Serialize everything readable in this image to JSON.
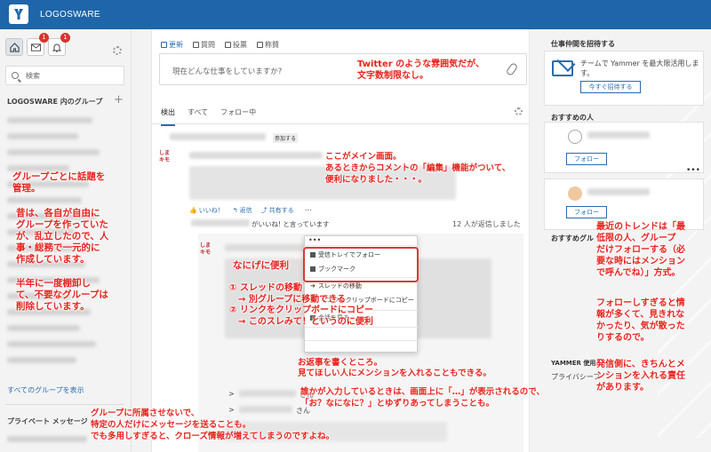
{
  "app": {
    "brand": "LOGOSWARE"
  },
  "left": {
    "nav_badges": {
      "inbox": "1",
      "notifications": "1"
    },
    "search_placeholder": "検索",
    "groups_title": "LOGOSWARE 内のグループ",
    "all_groups": "すべてのグループを表示",
    "private_title": "プライベート メッセージ"
  },
  "center": {
    "publisher_tabs": [
      "更新",
      "質問",
      "投票",
      "称賛"
    ],
    "composer_placeholder": "現在どんな仕事をしていますか?",
    "feed_tabs": [
      "検出",
      "すべて",
      "フォロー中"
    ],
    "post_tag": "参加する",
    "actions": {
      "like": "いいね！",
      "reply": "返信",
      "share": "共有する",
      "more": "..."
    },
    "likes_text": "がいいね! と言っています",
    "replies_info": "12 人が返信しました",
    "reply_suffix_1": "さん",
    "reply_suffix_2": "さん",
    "reply_marker": ">"
  },
  "menu": {
    "items": [
      "受信トレイでフォロー",
      "ブックマーク",
      "スレッドの移動",
      "リンクをクリップボードにコピー",
      "会話を見る"
    ]
  },
  "right": {
    "invite_title": "仕事仲間を招待する",
    "invite_text": "チームで Yammer を最大限活用します。",
    "invite_button": "今すぐ招待する",
    "suggested_title": "おすすめの人",
    "follow": "フォロー",
    "suggested_groups_title": "おすすめグル",
    "yammer_use": "YAMMER 使用/",
    "privacy": "プライバシーフ"
  },
  "annotations": {
    "a1": "Twitter のような雰囲気だが、\n文字数制限なし。",
    "a2": "ここがメイン画面。\nあるときからコメントの「編集」機能がついて、\n便利になりました・・・。",
    "a3": "グループごとに話題を\n管理。",
    "a4": "昔は、各自が自由に\nグループを作っていた\nが、乱立したので、人\n事・総務で一元的に\n作成しています。",
    "a5": "半年に一度棚卸し\nて、不要なグループは\n削除しています。",
    "a6": "なにげに便利",
    "a7": "① スレッドの移動\n　→ 別グループに移動できる\n② リンクをクリップボードにコピー\n　→ このスレみて！というのに便利",
    "a8": "最近のトレンドは「最\n低限の人、グループ\nだけフォローする（必\n要な時にはメンション\nで呼んでね）」方式。",
    "a9": "フォローしすぎると情\n報が多くて、見きれな\nかったり、気が散った\nりするので。",
    "a10": "お返事を書くところ。\n見てほしい人にメンションを入れることもできる。",
    "a11": "誰かが入力しているときは、画面上に「…」が表示されるので、\n「お？なになに？」とゆずりあってしまうことも。",
    "a12": "発信側に、きちんとメ\nンションを入れる責任\nがあります。",
    "a13": "グループに所属させないで、\n特定の人だけにメッセージを送ることも。\nでも多用しすぎると、クローズ情報が増えてしまうのですよね。"
  }
}
